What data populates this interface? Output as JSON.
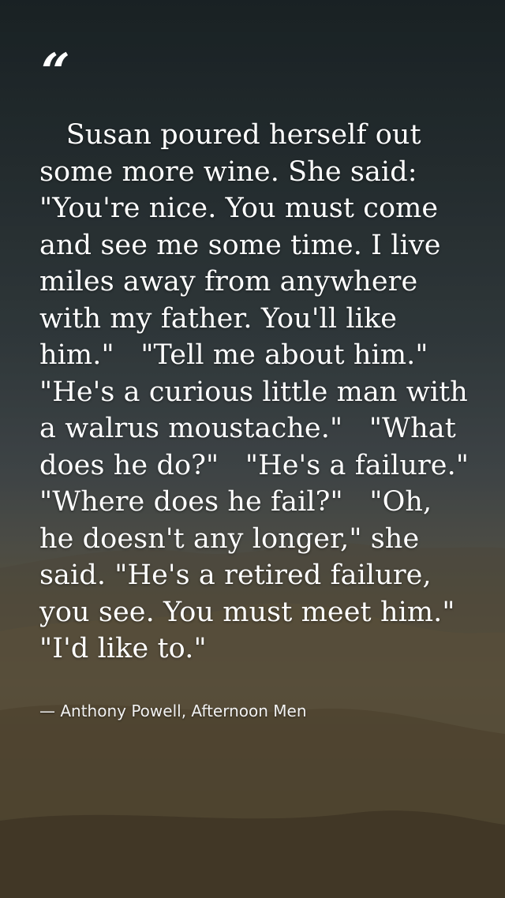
{
  "quote": {
    "mark": "“",
    "text": "   Susan poured herself out some more wine. She said:   \"You're nice. You must come and see me some time. I live miles away from anywhere with my father. You'll like him.\"   \"Tell me about him.\"   \"He's a curious little man with a walrus moustache.\"   \"What does he do?\"   \"He's a failure.\"   \"Where does he fail?\"   \"Oh, he doesn't any longer,\" she said. \"He's a retired failure, you see. You must meet him.\"   \"I'd like to.\"",
    "attribution": "— Anthony Powell, Afternoon Men"
  },
  "colors": {
    "text": "#ffffff",
    "sky_top": "#1f292c",
    "ground": "#7a6a4a"
  }
}
